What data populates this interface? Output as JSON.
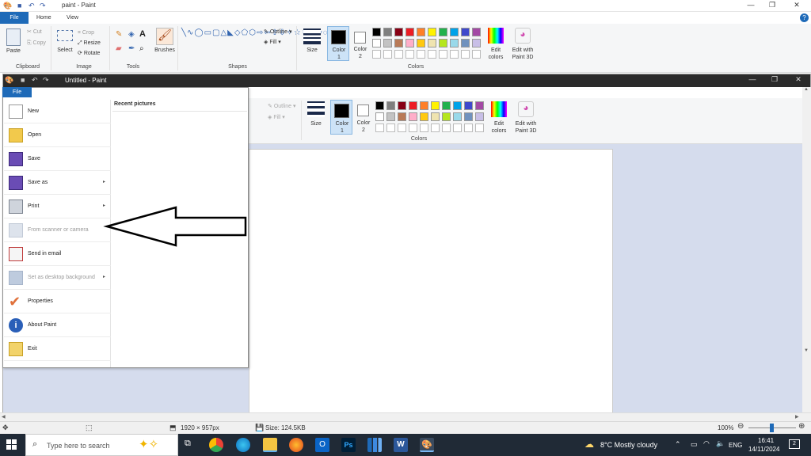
{
  "back": {
    "title": "paint - Paint",
    "tabs": [
      "File",
      "Home",
      "View"
    ],
    "clipboard": {
      "paste": "Paste",
      "cut": "Cut",
      "copy": "Copy",
      "group": "Clipboard"
    },
    "image": {
      "select": "Select",
      "crop": "Crop",
      "resize": "Resize",
      "rotate": "Rotate",
      "group": "Image"
    },
    "tools": {
      "group": "Tools"
    },
    "brushes": "Brushes",
    "shapes": {
      "group": "Shapes",
      "outline": "Outline",
      "fill": "Fill"
    },
    "size": "Size",
    "color1": "Color\n1",
    "color2": "Color\n2",
    "colors_group": "Colors",
    "edit_colors": "Edit\ncolors",
    "paint3d": "Edit with\nPaint 3D"
  },
  "front": {
    "title": "Untitled - Paint",
    "tab_file": "File",
    "outline": "Outline",
    "fill": "Fill",
    "size": "Size",
    "color1": "Color\n1",
    "color2": "Color\n2",
    "colors_group": "Colors",
    "edit_colors": "Edit\ncolors",
    "paint3d": "Edit with\nPaint 3D"
  },
  "palette": [
    "#000000",
    "#7f7f7f",
    "#880015",
    "#ed1c24",
    "#ff7f27",
    "#fff200",
    "#22b14c",
    "#00a2e8",
    "#3f48cc",
    "#a349a4",
    "#ffffff",
    "#c3c3c3",
    "#b97a57",
    "#ffaec9",
    "#ffc90e",
    "#efe4b0",
    "#b5e61d",
    "#99d9ea",
    "#7092be",
    "#c8bfe7"
  ],
  "file_menu": {
    "recent_header": "Recent pictures",
    "items": [
      {
        "label": "New",
        "icon": "new-document-icon",
        "arrow": false,
        "disabled": false
      },
      {
        "label": "Open",
        "icon": "open-folder-icon",
        "arrow": false,
        "disabled": false
      },
      {
        "label": "Save",
        "icon": "save-disk-icon",
        "arrow": false,
        "disabled": false
      },
      {
        "label": "Save as",
        "icon": "save-as-icon",
        "arrow": true,
        "disabled": false
      },
      {
        "label": "Print",
        "icon": "printer-icon",
        "arrow": true,
        "disabled": false
      },
      {
        "label": "From scanner or camera",
        "icon": "scanner-icon",
        "arrow": false,
        "disabled": true
      },
      {
        "label": "Send in email",
        "icon": "email-icon",
        "arrow": false,
        "disabled": false
      },
      {
        "label": "Set as desktop background",
        "icon": "desktop-background-icon",
        "arrow": true,
        "disabled": true
      },
      {
        "label": "Properties",
        "icon": "checkmark-icon",
        "arrow": false,
        "disabled": false
      },
      {
        "label": "About Paint",
        "icon": "info-icon",
        "arrow": false,
        "disabled": false
      },
      {
        "label": "Exit",
        "icon": "exit-icon",
        "arrow": false,
        "disabled": false
      }
    ]
  },
  "status": {
    "dimensions": "1920 × 957px",
    "size": "Size: 124.5KB",
    "zoom": "100%"
  },
  "taskbar": {
    "search_placeholder": "Type here to search",
    "weather": "8°C  Mostly cloudy",
    "lang": "ENG",
    "time": "16:41",
    "date": "14/11/2024",
    "notifications": "2"
  }
}
